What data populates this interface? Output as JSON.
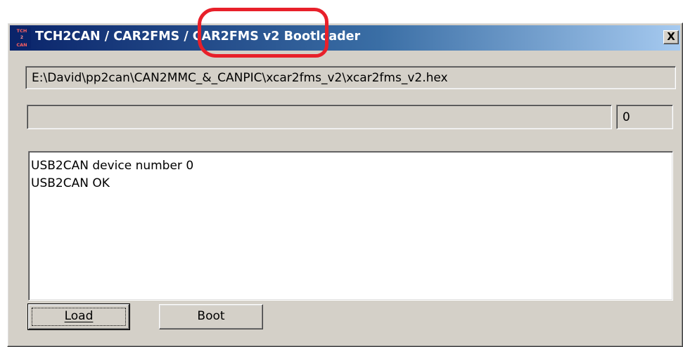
{
  "window": {
    "title": "TCH2CAN / CAR2FMS / CAR2FMS v2 Bootloader",
    "close_label": "X",
    "icon_lines": [
      "TCH",
      "2",
      "CAN"
    ]
  },
  "file_path": "E:\\David\\pp2can\\CAN2MMC_&_CANPIC\\xcar2fms_v2\\xcar2fms_v2.hex",
  "progress": {
    "fraction": 0,
    "count": "0"
  },
  "log": {
    "lines": [
      "USB2CAN device number 0",
      "USB2CAN OK"
    ]
  },
  "buttons": {
    "load_label": "Load",
    "boot_label": "Boot"
  },
  "colors": {
    "title_gradient_start": "#0a246a",
    "title_gradient_end": "#a6caf0",
    "dialog_face": "#d4d0c8",
    "annotation_ring": "#e8202a"
  }
}
